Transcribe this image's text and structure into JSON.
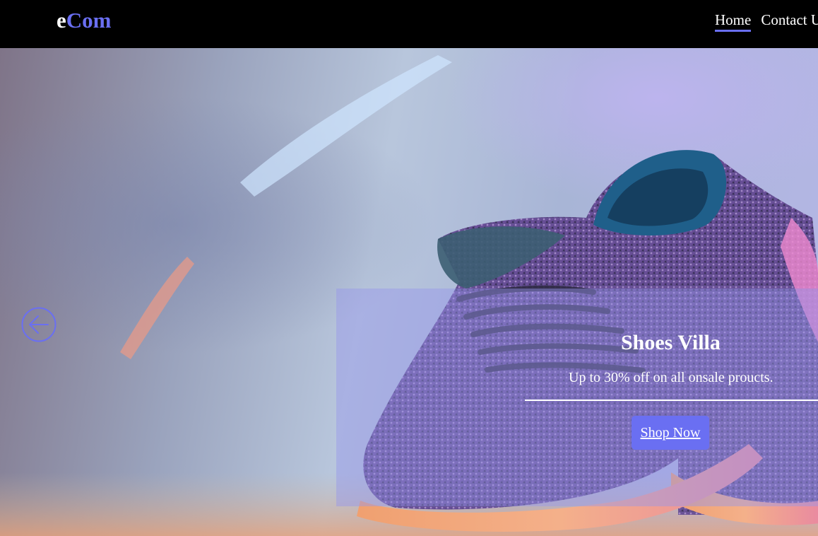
{
  "brand": {
    "prefix": "e",
    "suffix": "Com",
    "accent_color": "#6a6ff2"
  },
  "nav": {
    "items": [
      {
        "label": "Home",
        "active": true
      },
      {
        "label": "Contact Us",
        "active": false
      }
    ]
  },
  "carousel": {
    "prev_icon": "arrow-left-circle-icon",
    "slide": {
      "title": "Shoes Villa",
      "subtitle": "Up to 30% off on all onsale proucts.",
      "cta_label": "Shop Now"
    }
  }
}
